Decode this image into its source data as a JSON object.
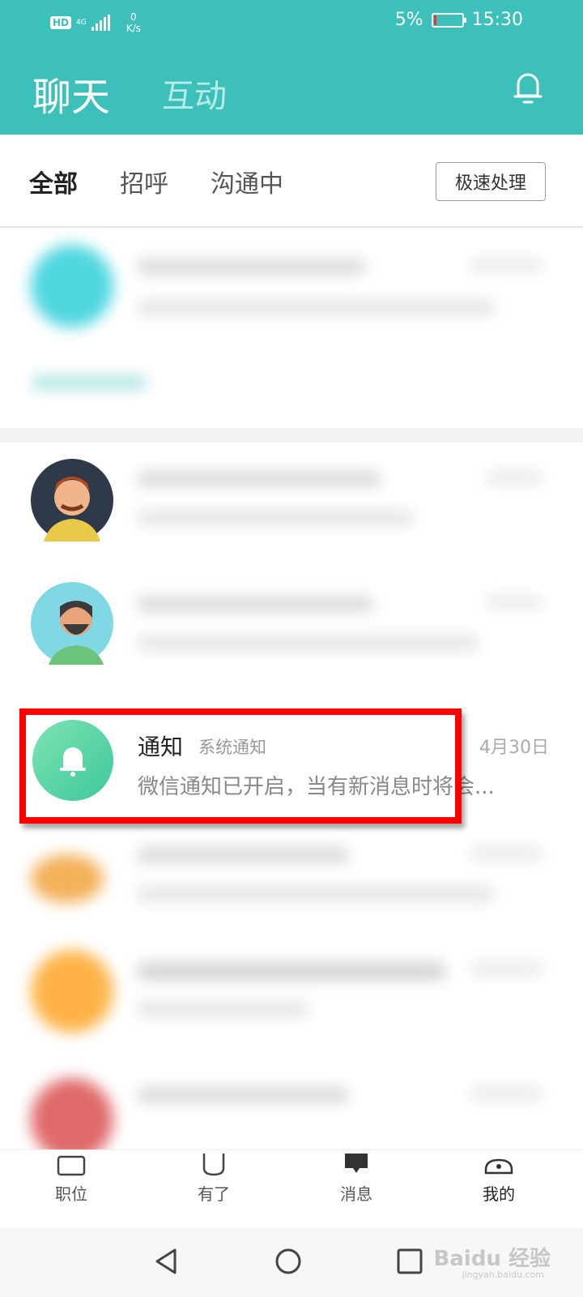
{
  "status_bar": {
    "hd": "HD",
    "network": "4G",
    "speed_value": "0",
    "speed_unit": "K/s",
    "battery": "5%",
    "time": "15:30"
  },
  "header": {
    "title": "聊天",
    "tab_interaction": "互动",
    "bell_icon": "bell-icon"
  },
  "filters": {
    "all": "全部",
    "greeting": "招呼",
    "communicating": "沟通中",
    "fast_process": "极速处理"
  },
  "notification_item": {
    "name": "通知",
    "tag": "系统通知",
    "date": "4月30日",
    "preview": "微信通知已开启，当有新消息时将会...",
    "icon": "bell-icon"
  },
  "bottom_nav": {
    "items": [
      {
        "label": "职位",
        "icon": "briefcase-icon"
      },
      {
        "label": "有了",
        "icon": "cup-icon"
      },
      {
        "label": "消息",
        "icon": "chat-icon"
      },
      {
        "label": "我的",
        "icon": "profile-icon"
      }
    ],
    "active": "我的"
  },
  "system_nav": {
    "back_icon": "triangle-back-icon",
    "home_icon": "circle-home-icon",
    "recents_icon": "square-recents-icon"
  },
  "watermark": {
    "brand": "Baidu 经验",
    "url": "jingyan.baidu.com"
  },
  "colors": {
    "header_bg": "#3cc0b9",
    "highlight_border": "#ff0000",
    "notification_avatar": "#4fd3a4"
  }
}
